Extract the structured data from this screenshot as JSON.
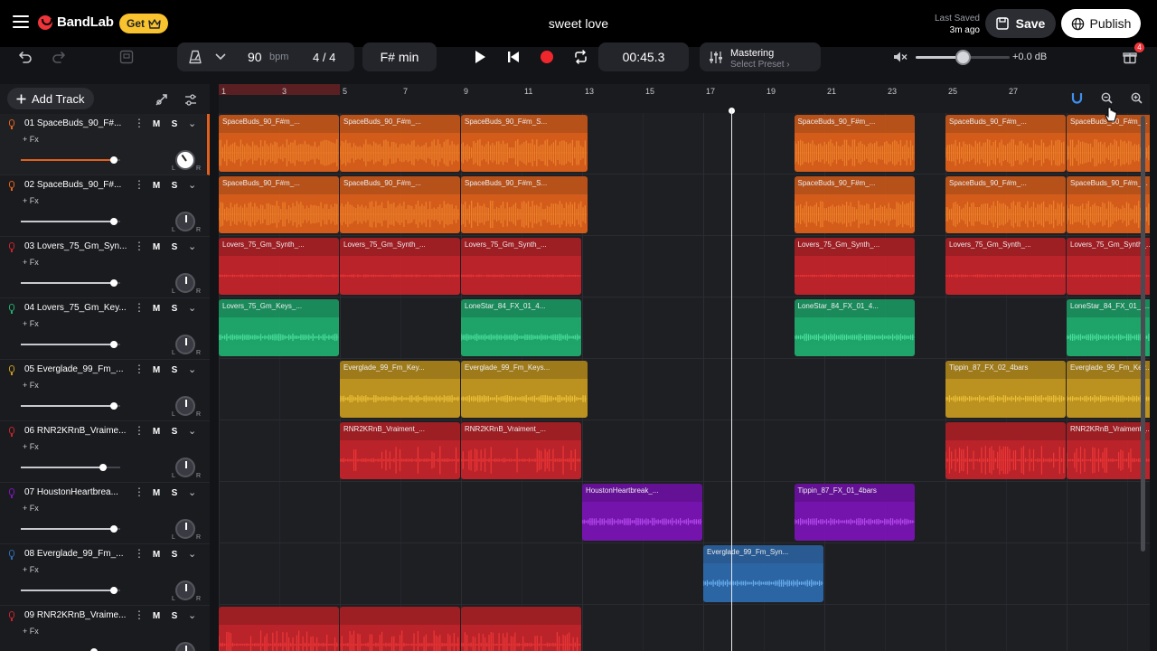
{
  "header": {
    "brand": "BandLab",
    "get_label": "Get",
    "song_title": "sweet love",
    "last_saved_label": "Last Saved",
    "last_saved_ago": "3m ago",
    "save_label": "Save",
    "publish_label": "Publish"
  },
  "toolbar": {
    "tempo": "90",
    "tempo_unit": "bpm",
    "time_sig": "4 / 4",
    "key": "F# min",
    "time": "00:45.3",
    "mastering_title": "Mastering",
    "mastering_sub": "Select Preset ›",
    "master_db": "+0.0 dB",
    "master_volume": 0.5,
    "notification_count": "4"
  },
  "left_panel": {
    "add_track_label": "Add Track",
    "fx_label": "+ Fx",
    "mute_label": "M",
    "solo_label": "S",
    "pan_l": "L",
    "pan_r": "R"
  },
  "ruler": {
    "bars": [
      "1",
      "3",
      "5",
      "7",
      "9",
      "11",
      "13",
      "15",
      "17",
      "19",
      "21",
      "23",
      "25",
      "27"
    ]
  },
  "colors": {
    "orange": "#e3621b",
    "red": "#c8242a",
    "green": "#1faf6f",
    "gold": "#c99b1f",
    "purple": "#7d14b8",
    "blue": "#2d6cb0"
  },
  "tracks": [
    {
      "name": "01  SpaceBuds_90_F#...",
      "color": "orange",
      "volume": 0.97,
      "active": true,
      "clips": [
        {
          "label": "SpaceBuds_90_F#m_...",
          "start": 1,
          "len": 2
        },
        {
          "label": "SpaceBuds_90_F#m_...",
          "start": 5,
          "len": 2
        },
        {
          "label": "SpaceBuds_90_F#m_S...",
          "start": 9,
          "len": 2.1
        },
        {
          "label": "SpaceBuds_90_F#m_...",
          "start": 20,
          "len": 2
        },
        {
          "label": "SpaceBuds_90_F#m_...",
          "start": 25,
          "len": 2
        },
        {
          "label": "SpaceBuds_90_F#m_...",
          "start": 29,
          "len": 2
        }
      ]
    },
    {
      "name": "02  SpaceBuds_90_F#...",
      "color": "orange",
      "volume": 0.97,
      "clips": [
        {
          "label": "SpaceBuds_90_F#m_...",
          "start": 1,
          "len": 2
        },
        {
          "label": "SpaceBuds_90_F#m_...",
          "start": 5,
          "len": 2
        },
        {
          "label": "SpaceBuds_90_F#m_S...",
          "start": 9,
          "len": 2.1
        },
        {
          "label": "SpaceBuds_90_F#m_...",
          "start": 20,
          "len": 2
        },
        {
          "label": "SpaceBuds_90_F#m_...",
          "start": 25,
          "len": 2
        },
        {
          "label": "SpaceBuds_90_F#m_...",
          "start": 29,
          "len": 2
        }
      ]
    },
    {
      "name": "03  Lovers_75_Gm_Syn...",
      "color": "red",
      "volume": 0.97,
      "clips": [
        {
          "label": "Lovers_75_Gm_Synth_...",
          "start": 1,
          "len": 2
        },
        {
          "label": "Lovers_75_Gm_Synth_...",
          "start": 5,
          "len": 2
        },
        {
          "label": "Lovers_75_Gm_Synth_...",
          "start": 9,
          "len": 2
        },
        {
          "label": "Lovers_75_Gm_Synth_...",
          "start": 20,
          "len": 2
        },
        {
          "label": "Lovers_75_Gm_Synth_...",
          "start": 25,
          "len": 2
        },
        {
          "label": "Lovers_75_Gm_Synth_...",
          "start": 29,
          "len": 2
        }
      ]
    },
    {
      "name": "04  Lovers_75_Gm_Key...",
      "color": "green",
      "volume": 0.97,
      "clips": [
        {
          "label": "Lovers_75_Gm_Keys_...",
          "start": 1,
          "len": 2
        },
        {
          "label": "LoneStar_84_FX_01_4...",
          "start": 9,
          "len": 2
        },
        {
          "label": "LoneStar_84_FX_01_4...",
          "start": 20,
          "len": 2
        },
        {
          "label": "LoneStar_84_FX_01_4...",
          "start": 29,
          "len": 2
        }
      ]
    },
    {
      "name": "05  Everglade_99_Fm_...",
      "color": "gold",
      "volume": 0.97,
      "clips": [
        {
          "label": "Everglade_99_Fm_Key...",
          "start": 5,
          "len": 2
        },
        {
          "label": "Everglade_99_Fm_Keys...",
          "start": 9,
          "len": 2.1
        },
        {
          "label": "Tippin_87_FX_02_4bars",
          "start": 25,
          "len": 2
        },
        {
          "label": "Everglade_99_Fm_Key...",
          "start": 29,
          "len": 2
        }
      ]
    },
    {
      "name": "06  RNR2KRnB_Vraime...",
      "color": "red",
      "volume": 0.86,
      "clips": [
        {
          "label": "RNR2KRnB_Vraiment_...",
          "start": 5,
          "len": 2
        },
        {
          "label": "RNR2KRnB_Vraiment_...",
          "start": 9,
          "len": 2
        },
        {
          "label": "",
          "start": 25,
          "len": 2
        },
        {
          "label": "RNR2KRnB_Vraiment_...",
          "start": 29,
          "len": 2
        }
      ]
    },
    {
      "name": "07  HoustonHeartbrea...",
      "color": "purple",
      "volume": 0.97,
      "clips": [
        {
          "label": "HoustonHeartbreak_...",
          "start": 13,
          "len": 2
        },
        {
          "label": "Tippin_87_FX_01_4bars",
          "start": 20,
          "len": 2
        }
      ]
    },
    {
      "name": "08  Everglade_99_Fm_...",
      "color": "blue",
      "volume": 0.97,
      "clips": [
        {
          "label": "Everglade_99_Fm_Syn...",
          "start": 17,
          "len": 2
        }
      ]
    },
    {
      "name": "09  RNR2KRnB_Vraime...",
      "color": "red",
      "volume": 0.76,
      "clips": [
        {
          "label": "",
          "start": 1,
          "len": 2
        },
        {
          "label": "",
          "start": 5,
          "len": 2
        },
        {
          "label": "",
          "start": 9,
          "len": 2
        }
      ]
    }
  ],
  "playhead_bar": 17.9
}
